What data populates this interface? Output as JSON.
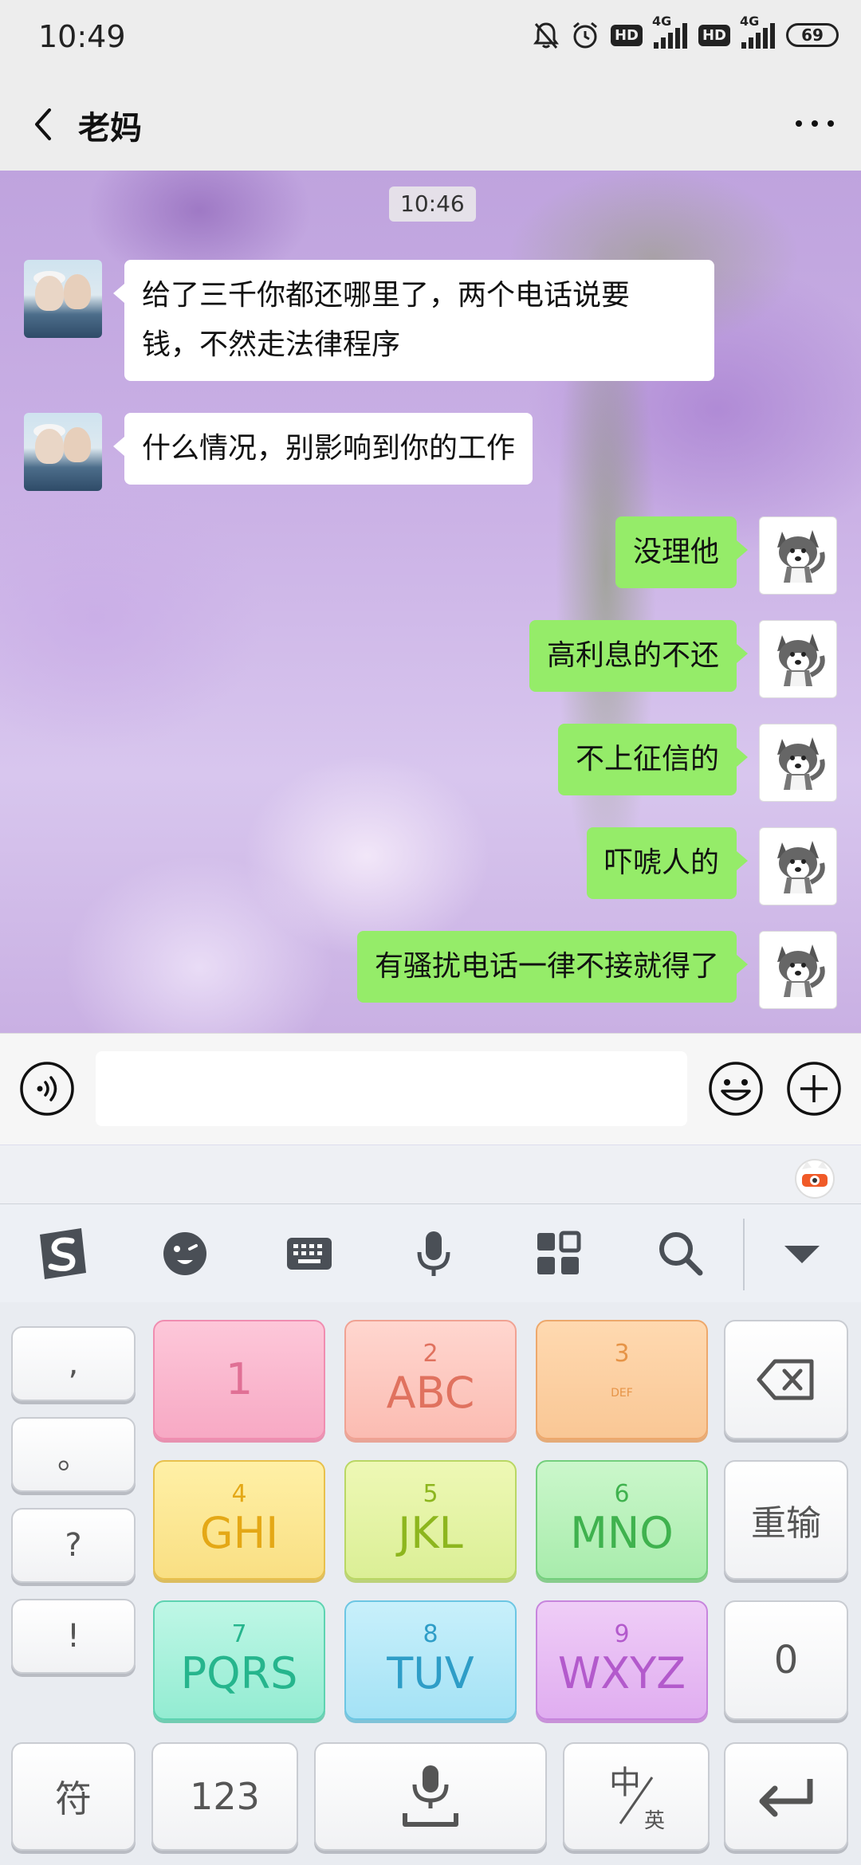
{
  "status": {
    "time": "10:49",
    "hd1": "HD",
    "net1": "4G",
    "hd2": "HD",
    "net2": "4G",
    "battery": "69"
  },
  "chat": {
    "title": "老妈",
    "timestamp": "10:46",
    "messages": [
      {
        "side": "left",
        "text_line1": "给了三千你都还哪里了，两个电话说要",
        "text_line2": "钱，不然走法律程序"
      },
      {
        "side": "left",
        "text": "什么情况，别影响到你的工作"
      },
      {
        "side": "right",
        "text": "没理他"
      },
      {
        "side": "right",
        "text": "高利息的不还"
      },
      {
        "side": "right",
        "text": "不上征信的"
      },
      {
        "side": "right",
        "text": "吓唬人的"
      },
      {
        "side": "right",
        "text": "有骚扰电话一律不接就得了"
      }
    ]
  },
  "icons": {
    "back": "chevron-left-icon",
    "more": "more-dots-icon",
    "voice": "voice-icon",
    "emoji": "smiley-icon",
    "plus": "plus-circle-icon",
    "ime_logo": "sogou-logo-icon",
    "ime_tools": [
      "emoji-face-icon",
      "keyboard-icon",
      "microphone-icon",
      "grid-apps-icon",
      "search-icon",
      "collapse-down-icon"
    ]
  },
  "keyboard": {
    "punct": [
      ",",
      "。",
      "?",
      "!"
    ],
    "keys": [
      {
        "num": "",
        "letters": "1"
      },
      {
        "num": "2",
        "letters": "ABC"
      },
      {
        "num": "3",
        "letters": "DEF"
      },
      {
        "num": "4",
        "letters": "GHI"
      },
      {
        "num": "5",
        "letters": "JKL"
      },
      {
        "num": "6",
        "letters": "MNO"
      },
      {
        "num": "7",
        "letters": "PQRS"
      },
      {
        "num": "8",
        "letters": "TUV"
      },
      {
        "num": "9",
        "letters": "WXYZ"
      }
    ],
    "retype": "重输",
    "zero": "0",
    "symbols": "符",
    "numbers": "123",
    "lang_zh": "中",
    "lang_en": "英"
  }
}
